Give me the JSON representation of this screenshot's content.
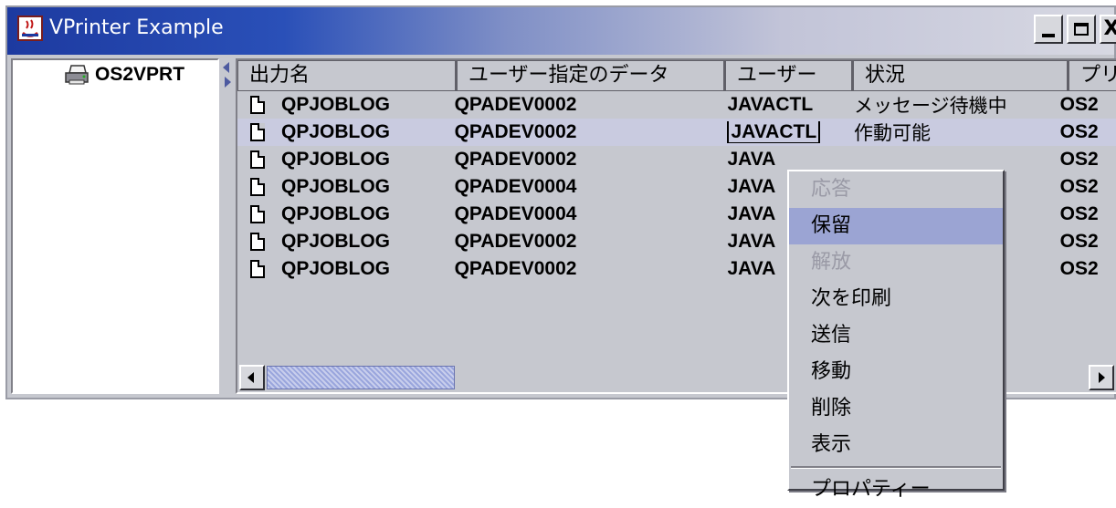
{
  "window": {
    "title": "VPrinter Example",
    "controls": [
      "minimize",
      "maximize",
      "close"
    ],
    "close_glyph": "X"
  },
  "tree": {
    "items": [
      {
        "label": "OS2VPRT",
        "icon": "printer-icon"
      }
    ]
  },
  "table": {
    "columns": [
      "出力名",
      "ユーザー指定のデータ",
      "ユーザー",
      "状況",
      "プリ"
    ],
    "rows": [
      {
        "name": "QPJOBLOG",
        "data": "QPADEV0002",
        "user": "JAVACTL",
        "status": "メッセージ待機中",
        "printer": "OS2"
      },
      {
        "name": "QPJOBLOG",
        "data": "QPADEV0002",
        "user": "JAVACTL",
        "status": "作動可能",
        "printer": "OS2",
        "selected": true
      },
      {
        "name": "QPJOBLOG",
        "data": "QPADEV0002",
        "user": "JAVA",
        "status": "",
        "printer": "OS2"
      },
      {
        "name": "QPJOBLOG",
        "data": "QPADEV0004",
        "user": "JAVA",
        "status": "",
        "printer": "OS2"
      },
      {
        "name": "QPJOBLOG",
        "data": "QPADEV0004",
        "user": "JAVA",
        "status": "",
        "printer": "OS2"
      },
      {
        "name": "QPJOBLOG",
        "data": "QPADEV0002",
        "user": "JAVA",
        "status": "",
        "printer": "OS2"
      },
      {
        "name": "QPJOBLOG",
        "data": "QPADEV0002",
        "user": "JAVA",
        "status": "",
        "printer": "OS2"
      }
    ]
  },
  "context_menu": {
    "items": [
      {
        "label": "応答",
        "disabled": true
      },
      {
        "label": "保留",
        "highlighted": true
      },
      {
        "label": "解放",
        "disabled": true
      },
      {
        "label": "次を印刷"
      },
      {
        "label": "送信"
      },
      {
        "label": "移動"
      },
      {
        "label": "削除"
      },
      {
        "label": "表示"
      },
      {
        "separator": true
      },
      {
        "label": "プロパティー"
      }
    ]
  },
  "colors": {
    "title_gradient_start": "#1d3aa0",
    "selection": "#c9cbe0",
    "menu_highlight": "#9ba4d3",
    "scroll_thumb": "#9aa6dd"
  }
}
